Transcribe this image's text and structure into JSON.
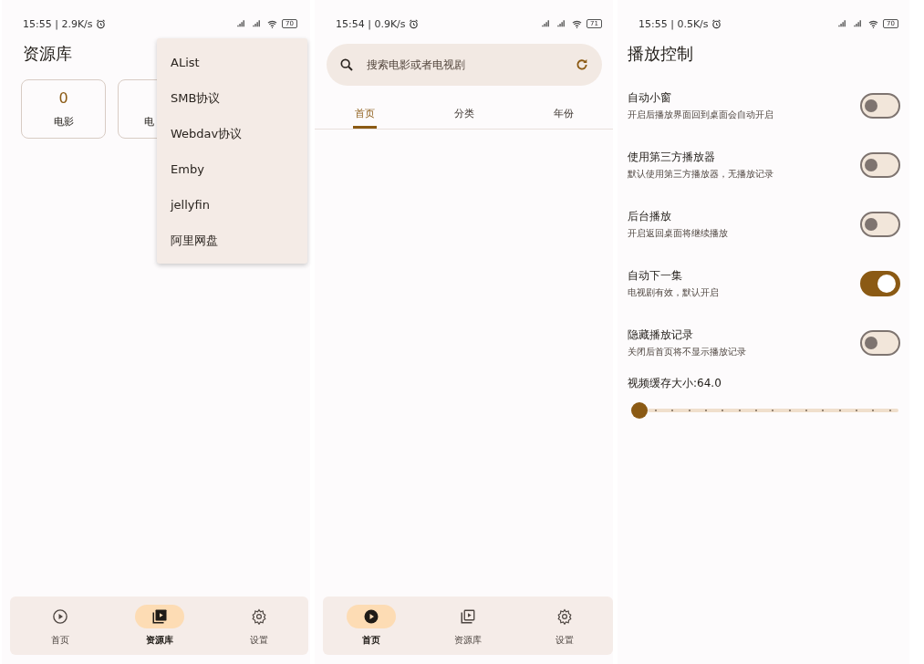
{
  "screens": [
    {
      "kind": "library",
      "status": {
        "time": "15:55 | 2.9K/s",
        "battery": "70"
      },
      "title": "资源库",
      "cards": [
        {
          "count": "0",
          "label": "电影"
        },
        {
          "label": "电"
        }
      ],
      "menu": [
        "AList",
        "SMB协议",
        "Webdav协议",
        "Emby",
        "jellyfin",
        "阿里网盘"
      ],
      "nav": [
        {
          "label": "首页",
          "selected": false
        },
        {
          "label": "资源库",
          "selected": true
        },
        {
          "label": "设置",
          "selected": false
        }
      ]
    },
    {
      "kind": "home",
      "status": {
        "time": "15:54 | 0.9K/s",
        "battery": "71"
      },
      "search": {
        "placeholder": "搜索电影或者电视剧"
      },
      "tabs": [
        {
          "label": "首页",
          "selected": true
        },
        {
          "label": "分类",
          "selected": false
        },
        {
          "label": "年份",
          "selected": false
        }
      ],
      "nav": [
        {
          "label": "首页",
          "selected": true
        },
        {
          "label": "资源库",
          "selected": false
        },
        {
          "label": "设置",
          "selected": false
        }
      ]
    },
    {
      "kind": "settings",
      "status": {
        "time": "15:55 | 0.5K/s",
        "battery": "70"
      },
      "title": "播放控制",
      "settings": [
        {
          "title": "自动小窗",
          "subtitle": "开启后播放界面回到桌面会自动开启",
          "on": false
        },
        {
          "title": "使用第三方播放器",
          "subtitle": "默认使用第三方播放器，无播放记录",
          "on": false
        },
        {
          "title": "后台播放",
          "subtitle": "开启返回桌面将继续播放",
          "on": false
        },
        {
          "title": "自动下一集",
          "subtitle": "电视剧有效，默认开启",
          "on": true
        },
        {
          "title": "隐藏播放记录",
          "subtitle": "关闭后首页将不显示播放记录",
          "on": false
        }
      ],
      "slider": {
        "label": "视频缓存大小:",
        "value": "64.0",
        "level": 0
      }
    }
  ]
}
